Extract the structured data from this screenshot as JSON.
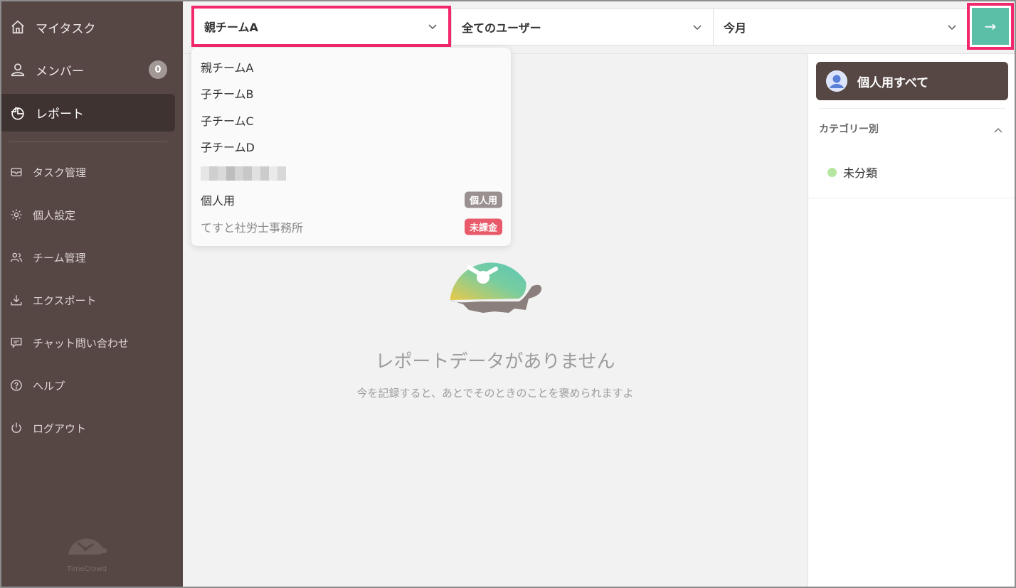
{
  "sidebar": {
    "primary": [
      {
        "label": "マイタスク",
        "icon": "home-icon"
      },
      {
        "label": "メンバー",
        "icon": "user-icon",
        "badge": "0"
      },
      {
        "label": "レポート",
        "icon": "pie-chart-icon",
        "active": true
      }
    ],
    "secondary": [
      {
        "label": "タスク管理",
        "icon": "inbox-icon"
      },
      {
        "label": "個人設定",
        "icon": "gear-icon"
      },
      {
        "label": "チーム管理",
        "icon": "team-icon"
      },
      {
        "label": "エクスポート",
        "icon": "download-icon"
      },
      {
        "label": "チャット問い合わせ",
        "icon": "chat-icon"
      },
      {
        "label": "ヘルプ",
        "icon": "help-icon"
      },
      {
        "label": "ログアウト",
        "icon": "power-icon"
      }
    ],
    "logo_text": "TimeCrowd"
  },
  "toolbar": {
    "team_select": "親チームA",
    "user_select": "全てのユーザー",
    "period_select": "今月",
    "go_symbol": "→"
  },
  "dropdown": {
    "options": [
      {
        "label": "親チームA"
      },
      {
        "label": "子チームB"
      },
      {
        "label": "子チームC"
      },
      {
        "label": "子チームD"
      },
      {
        "label": ""
      },
      {
        "label": "個人用",
        "tag": "個人用"
      },
      {
        "label": "てすと社労士事務所",
        "tag": "未課金",
        "muted": true
      }
    ]
  },
  "main": {
    "empty_title": "レポートデータがありません",
    "empty_subtitle": "今を記録すると、あとでそのときのことを褒められますよ"
  },
  "right_panel": {
    "personal_button": "個人用すべて",
    "category_header": "カテゴリー別",
    "categories": [
      {
        "label": "未分類"
      }
    ]
  },
  "colors": {
    "sidebar_bg": "#564745",
    "highlight": "#f2276d",
    "accent_teal": "#5bbfa8",
    "tag_personal": "#9a9090",
    "tag_unpaid": "#e85a6a",
    "category_dot": "#b6e6a0"
  }
}
